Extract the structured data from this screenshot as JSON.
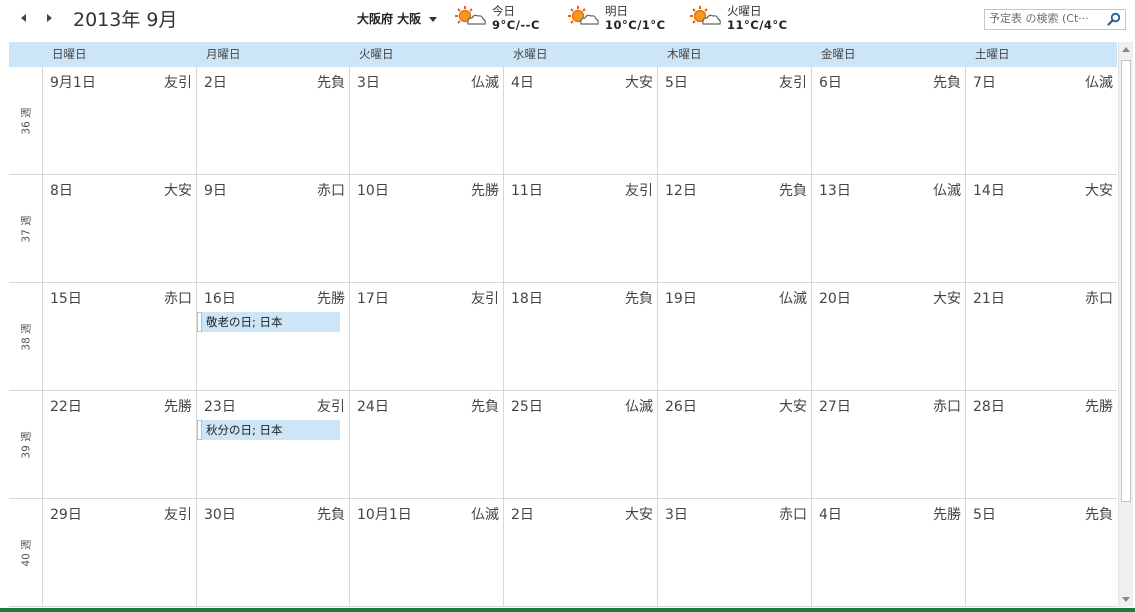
{
  "header": {
    "title": "2013年 9月",
    "location": "大阪府 大阪",
    "search_placeholder": "予定表 の検索 (Ct···"
  },
  "weather": [
    {
      "label": "今日",
      "temp": "9°C/--C",
      "icon": "partly-sunny-icon"
    },
    {
      "label": "明日",
      "temp": "10°C/1°C",
      "icon": "partly-sunny-icon"
    },
    {
      "label": "火曜日",
      "temp": "11°C/4°C",
      "icon": "partly-sunny-icon"
    }
  ],
  "weekdays": [
    "日曜日",
    "月曜日",
    "火曜日",
    "水曜日",
    "木曜日",
    "金曜日",
    "土曜日"
  ],
  "weeks": [
    {
      "label": "36 週",
      "days": [
        {
          "date": "9月1日",
          "rokuyo": "友引"
        },
        {
          "date": "2日",
          "rokuyo": "先負"
        },
        {
          "date": "3日",
          "rokuyo": "仏滅"
        },
        {
          "date": "4日",
          "rokuyo": "大安"
        },
        {
          "date": "5日",
          "rokuyo": "友引"
        },
        {
          "date": "6日",
          "rokuyo": "先負"
        },
        {
          "date": "7日",
          "rokuyo": "仏滅"
        }
      ]
    },
    {
      "label": "37 週",
      "days": [
        {
          "date": "8日",
          "rokuyo": "大安"
        },
        {
          "date": "9日",
          "rokuyo": "赤口"
        },
        {
          "date": "10日",
          "rokuyo": "先勝"
        },
        {
          "date": "11日",
          "rokuyo": "友引"
        },
        {
          "date": "12日",
          "rokuyo": "先負"
        },
        {
          "date": "13日",
          "rokuyo": "仏滅"
        },
        {
          "date": "14日",
          "rokuyo": "大安"
        }
      ]
    },
    {
      "label": "38 週",
      "days": [
        {
          "date": "15日",
          "rokuyo": "赤口"
        },
        {
          "date": "16日",
          "rokuyo": "先勝",
          "event": "敬老の日; 日本"
        },
        {
          "date": "17日",
          "rokuyo": "友引"
        },
        {
          "date": "18日",
          "rokuyo": "先負"
        },
        {
          "date": "19日",
          "rokuyo": "仏滅"
        },
        {
          "date": "20日",
          "rokuyo": "大安"
        },
        {
          "date": "21日",
          "rokuyo": "赤口"
        }
      ]
    },
    {
      "label": "39 週",
      "days": [
        {
          "date": "22日",
          "rokuyo": "先勝"
        },
        {
          "date": "23日",
          "rokuyo": "友引",
          "event": "秋分の日; 日本"
        },
        {
          "date": "24日",
          "rokuyo": "先負"
        },
        {
          "date": "25日",
          "rokuyo": "仏滅"
        },
        {
          "date": "26日",
          "rokuyo": "大安"
        },
        {
          "date": "27日",
          "rokuyo": "赤口"
        },
        {
          "date": "28日",
          "rokuyo": "先勝"
        }
      ]
    },
    {
      "label": "40 週",
      "days": [
        {
          "date": "29日",
          "rokuyo": "友引"
        },
        {
          "date": "30日",
          "rokuyo": "先負"
        },
        {
          "date": "10月1日",
          "rokuyo": "仏滅"
        },
        {
          "date": "2日",
          "rokuyo": "大安"
        },
        {
          "date": "3日",
          "rokuyo": "赤口"
        },
        {
          "date": "4日",
          "rokuyo": "先勝"
        },
        {
          "date": "5日",
          "rokuyo": "先負"
        }
      ]
    }
  ],
  "colors": {
    "header_bg": "#cde6f7",
    "event_bg": "#cde6f7",
    "grid": "#d7d7d7",
    "status_bar": "#1e7d3a"
  }
}
